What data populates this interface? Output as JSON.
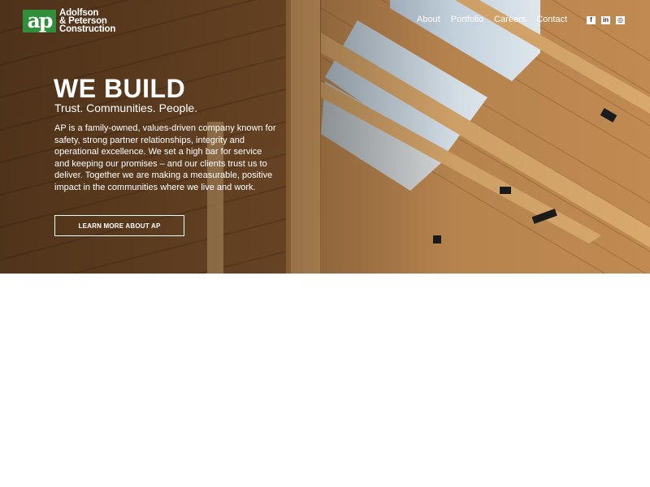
{
  "brand": {
    "logo_mark": "ap",
    "name_lines": [
      "Adolfson",
      "& Peterson",
      "Construction"
    ],
    "accent": "#2f8f3a"
  },
  "nav": {
    "items": [
      {
        "label": "About"
      },
      {
        "label": "Portfolio"
      },
      {
        "label": "Careers"
      },
      {
        "label": "Contact"
      }
    ]
  },
  "social": [
    {
      "icon": "facebook-icon",
      "glyph": "f"
    },
    {
      "icon": "linkedin-icon",
      "glyph": "in"
    },
    {
      "icon": "instagram-icon",
      "glyph": "◎"
    }
  ],
  "hero": {
    "headline": "WE BUILD",
    "subhead": "Trust. Communities. People.",
    "body": "AP is a family-owned, values-driven company known for safety, strong partner relationships, integrity and operational excellence. We set a high bar for service and keeping our promises – and our clients trust us to deliver. Together we are making a measurable, positive impact in the communities where we live and work.",
    "cta_label": "LEARN MORE ABOUT AP"
  }
}
